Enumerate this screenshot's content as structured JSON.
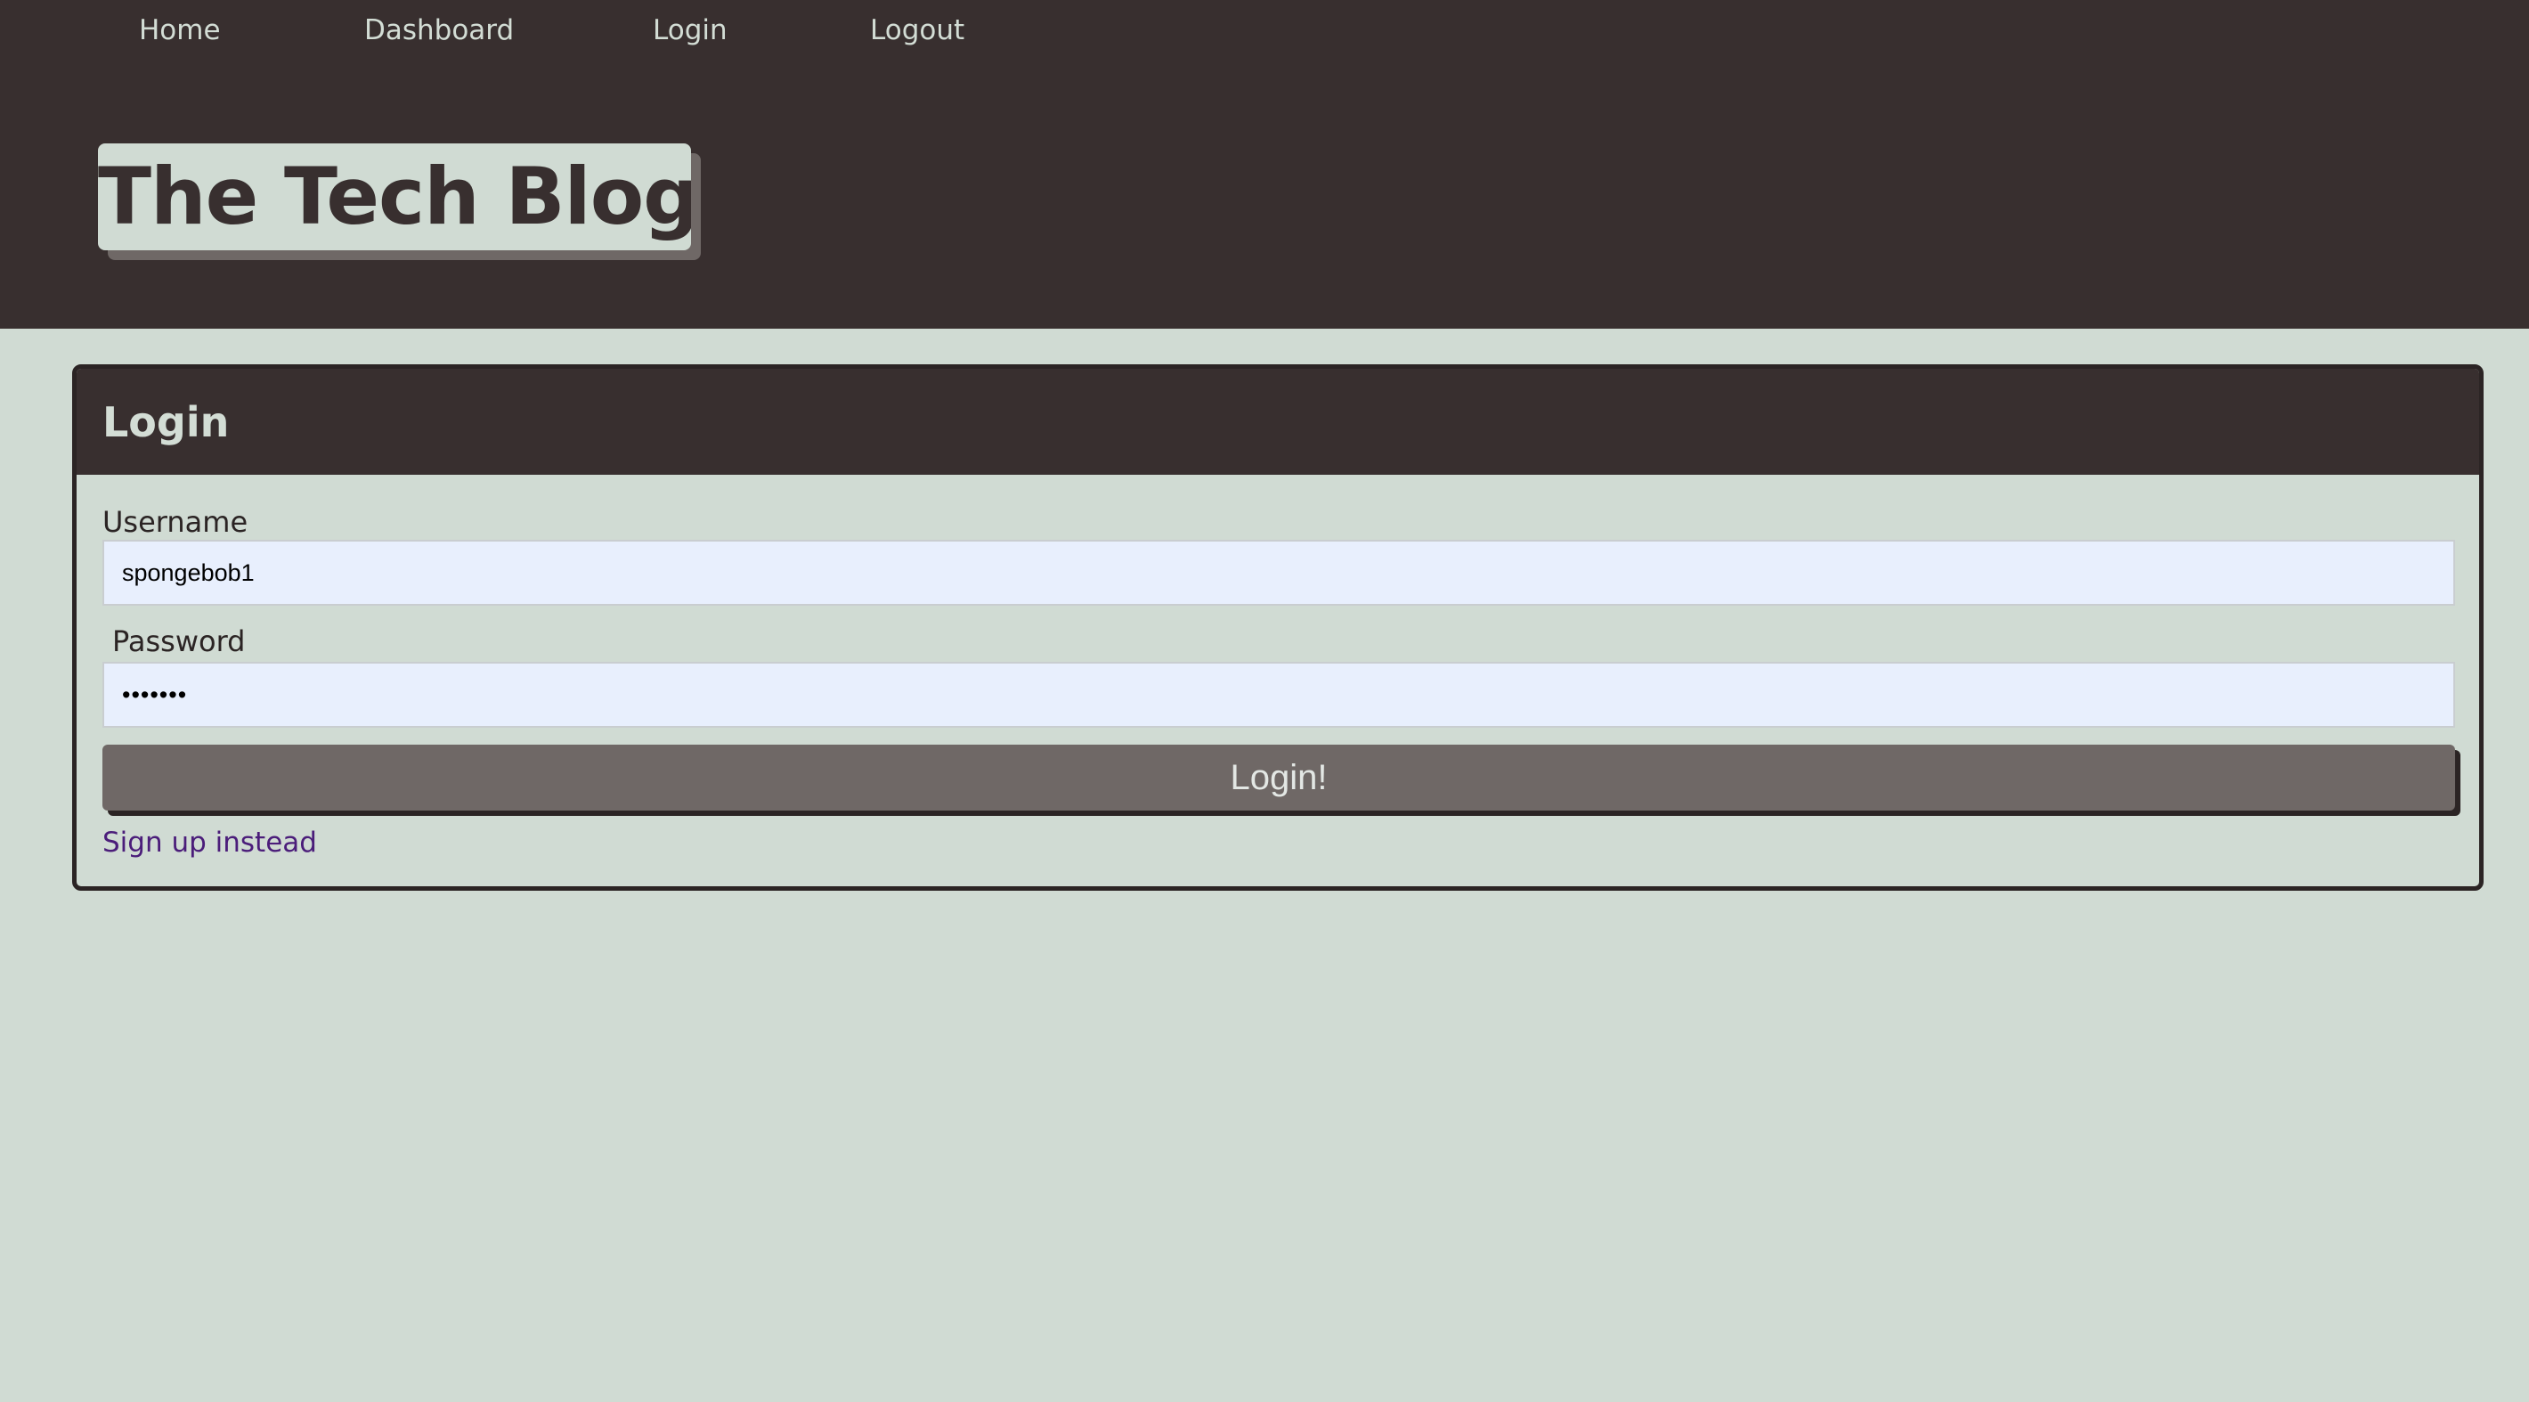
{
  "nav": {
    "items": [
      {
        "label": "Home"
      },
      {
        "label": "Dashboard"
      },
      {
        "label": "Login"
      },
      {
        "label": "Logout"
      }
    ]
  },
  "header": {
    "title": "The Tech Blog"
  },
  "login_card": {
    "title": "Login",
    "username": {
      "label": "Username",
      "value": "spongebob1"
    },
    "password": {
      "label": "Password",
      "value": "•••••••"
    },
    "submit_label": "Login!",
    "signup_link": "Sign up instead"
  },
  "colors": {
    "header_bg": "#382f2f",
    "page_bg": "#d0dbd3",
    "button_bg": "#6f6866",
    "input_bg": "#e8effd",
    "link": "#4b1d7a"
  }
}
